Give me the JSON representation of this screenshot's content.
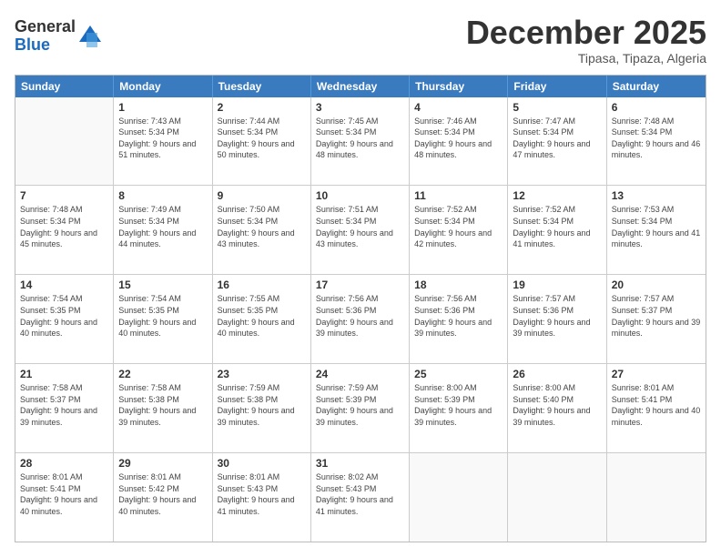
{
  "logo": {
    "general": "General",
    "blue": "Blue"
  },
  "header": {
    "month_year": "December 2025",
    "location": "Tipasa, Tipaza, Algeria"
  },
  "days_of_week": [
    "Sunday",
    "Monday",
    "Tuesday",
    "Wednesday",
    "Thursday",
    "Friday",
    "Saturday"
  ],
  "weeks": [
    [
      {
        "day": "",
        "sunrise": "",
        "sunset": "",
        "daylight": ""
      },
      {
        "day": "1",
        "sunrise": "Sunrise: 7:43 AM",
        "sunset": "Sunset: 5:34 PM",
        "daylight": "Daylight: 9 hours and 51 minutes."
      },
      {
        "day": "2",
        "sunrise": "Sunrise: 7:44 AM",
        "sunset": "Sunset: 5:34 PM",
        "daylight": "Daylight: 9 hours and 50 minutes."
      },
      {
        "day": "3",
        "sunrise": "Sunrise: 7:45 AM",
        "sunset": "Sunset: 5:34 PM",
        "daylight": "Daylight: 9 hours and 48 minutes."
      },
      {
        "day": "4",
        "sunrise": "Sunrise: 7:46 AM",
        "sunset": "Sunset: 5:34 PM",
        "daylight": "Daylight: 9 hours and 48 minutes."
      },
      {
        "day": "5",
        "sunrise": "Sunrise: 7:47 AM",
        "sunset": "Sunset: 5:34 PM",
        "daylight": "Daylight: 9 hours and 47 minutes."
      },
      {
        "day": "6",
        "sunrise": "Sunrise: 7:48 AM",
        "sunset": "Sunset: 5:34 PM",
        "daylight": "Daylight: 9 hours and 46 minutes."
      }
    ],
    [
      {
        "day": "7",
        "sunrise": "Sunrise: 7:48 AM",
        "sunset": "Sunset: 5:34 PM",
        "daylight": "Daylight: 9 hours and 45 minutes."
      },
      {
        "day": "8",
        "sunrise": "Sunrise: 7:49 AM",
        "sunset": "Sunset: 5:34 PM",
        "daylight": "Daylight: 9 hours and 44 minutes."
      },
      {
        "day": "9",
        "sunrise": "Sunrise: 7:50 AM",
        "sunset": "Sunset: 5:34 PM",
        "daylight": "Daylight: 9 hours and 43 minutes."
      },
      {
        "day": "10",
        "sunrise": "Sunrise: 7:51 AM",
        "sunset": "Sunset: 5:34 PM",
        "daylight": "Daylight: 9 hours and 43 minutes."
      },
      {
        "day": "11",
        "sunrise": "Sunrise: 7:52 AM",
        "sunset": "Sunset: 5:34 PM",
        "daylight": "Daylight: 9 hours and 42 minutes."
      },
      {
        "day": "12",
        "sunrise": "Sunrise: 7:52 AM",
        "sunset": "Sunset: 5:34 PM",
        "daylight": "Daylight: 9 hours and 41 minutes."
      },
      {
        "day": "13",
        "sunrise": "Sunrise: 7:53 AM",
        "sunset": "Sunset: 5:34 PM",
        "daylight": "Daylight: 9 hours and 41 minutes."
      }
    ],
    [
      {
        "day": "14",
        "sunrise": "Sunrise: 7:54 AM",
        "sunset": "Sunset: 5:35 PM",
        "daylight": "Daylight: 9 hours and 40 minutes."
      },
      {
        "day": "15",
        "sunrise": "Sunrise: 7:54 AM",
        "sunset": "Sunset: 5:35 PM",
        "daylight": "Daylight: 9 hours and 40 minutes."
      },
      {
        "day": "16",
        "sunrise": "Sunrise: 7:55 AM",
        "sunset": "Sunset: 5:35 PM",
        "daylight": "Daylight: 9 hours and 40 minutes."
      },
      {
        "day": "17",
        "sunrise": "Sunrise: 7:56 AM",
        "sunset": "Sunset: 5:36 PM",
        "daylight": "Daylight: 9 hours and 39 minutes."
      },
      {
        "day": "18",
        "sunrise": "Sunrise: 7:56 AM",
        "sunset": "Sunset: 5:36 PM",
        "daylight": "Daylight: 9 hours and 39 minutes."
      },
      {
        "day": "19",
        "sunrise": "Sunrise: 7:57 AM",
        "sunset": "Sunset: 5:36 PM",
        "daylight": "Daylight: 9 hours and 39 minutes."
      },
      {
        "day": "20",
        "sunrise": "Sunrise: 7:57 AM",
        "sunset": "Sunset: 5:37 PM",
        "daylight": "Daylight: 9 hours and 39 minutes."
      }
    ],
    [
      {
        "day": "21",
        "sunrise": "Sunrise: 7:58 AM",
        "sunset": "Sunset: 5:37 PM",
        "daylight": "Daylight: 9 hours and 39 minutes."
      },
      {
        "day": "22",
        "sunrise": "Sunrise: 7:58 AM",
        "sunset": "Sunset: 5:38 PM",
        "daylight": "Daylight: 9 hours and 39 minutes."
      },
      {
        "day": "23",
        "sunrise": "Sunrise: 7:59 AM",
        "sunset": "Sunset: 5:38 PM",
        "daylight": "Daylight: 9 hours and 39 minutes."
      },
      {
        "day": "24",
        "sunrise": "Sunrise: 7:59 AM",
        "sunset": "Sunset: 5:39 PM",
        "daylight": "Daylight: 9 hours and 39 minutes."
      },
      {
        "day": "25",
        "sunrise": "Sunrise: 8:00 AM",
        "sunset": "Sunset: 5:39 PM",
        "daylight": "Daylight: 9 hours and 39 minutes."
      },
      {
        "day": "26",
        "sunrise": "Sunrise: 8:00 AM",
        "sunset": "Sunset: 5:40 PM",
        "daylight": "Daylight: 9 hours and 39 minutes."
      },
      {
        "day": "27",
        "sunrise": "Sunrise: 8:01 AM",
        "sunset": "Sunset: 5:41 PM",
        "daylight": "Daylight: 9 hours and 40 minutes."
      }
    ],
    [
      {
        "day": "28",
        "sunrise": "Sunrise: 8:01 AM",
        "sunset": "Sunset: 5:41 PM",
        "daylight": "Daylight: 9 hours and 40 minutes."
      },
      {
        "day": "29",
        "sunrise": "Sunrise: 8:01 AM",
        "sunset": "Sunset: 5:42 PM",
        "daylight": "Daylight: 9 hours and 40 minutes."
      },
      {
        "day": "30",
        "sunrise": "Sunrise: 8:01 AM",
        "sunset": "Sunset: 5:43 PM",
        "daylight": "Daylight: 9 hours and 41 minutes."
      },
      {
        "day": "31",
        "sunrise": "Sunrise: 8:02 AM",
        "sunset": "Sunset: 5:43 PM",
        "daylight": "Daylight: 9 hours and 41 minutes."
      },
      {
        "day": "",
        "sunrise": "",
        "sunset": "",
        "daylight": ""
      },
      {
        "day": "",
        "sunrise": "",
        "sunset": "",
        "daylight": ""
      },
      {
        "day": "",
        "sunrise": "",
        "sunset": "",
        "daylight": ""
      }
    ]
  ]
}
